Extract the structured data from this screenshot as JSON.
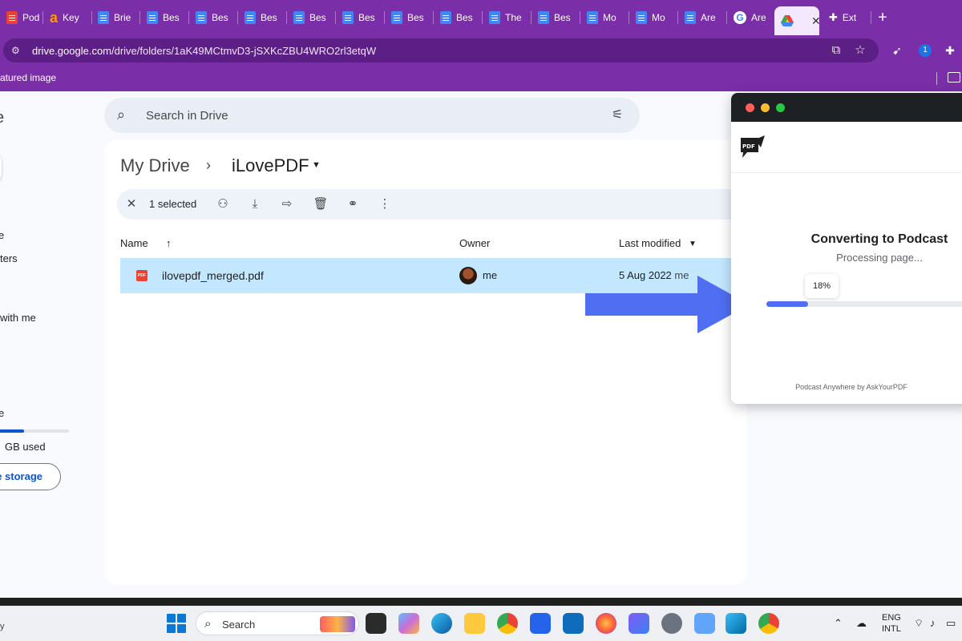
{
  "browser": {
    "tabs": [
      "Pod",
      "Key",
      "Brie",
      "Bes",
      "Bes",
      "Bes",
      "Bes",
      "Bes",
      "Bes",
      "Bes",
      "The",
      "Bes",
      "Mo",
      "Mo",
      "Are",
      "Are",
      "",
      "Ext"
    ],
    "url_host": "drive.google.com",
    "url_path": "/drive/folders/1aK49MCtmvD3-jSXKcZBU4WRO2rl3etqW",
    "bookmark": "atured image",
    "ext_badge": "1"
  },
  "drive": {
    "logo_partial": "e",
    "sidebar": [
      "e",
      "ters",
      "with me",
      "e"
    ],
    "storage_used": "GB used",
    "storage_button": "e storage",
    "storage_fraction": 0.42,
    "search_placeholder": "Search in Drive",
    "breadcrumb_root": "My Drive",
    "breadcrumb_folder": "iLovePDF",
    "selection_count": "1 selected",
    "columns": {
      "name": "Name",
      "owner": "Owner",
      "modified": "Last modified"
    },
    "files": [
      {
        "icon_label": "PDF",
        "name": "ilovepdf_merged.pdf",
        "owner": "me",
        "modified": "5 Aug 2022",
        "modified_by": "me"
      }
    ]
  },
  "popup": {
    "title": "Converting to Podcast",
    "status": "Processing page...",
    "progress_label": "18%",
    "progress": 0.18,
    "footer": "Podcast Anywhere by AskYourPDF",
    "logo_text": "PDF"
  },
  "taskbar": {
    "search_label": "Search",
    "lang_1": "ENG",
    "lang_2": "INTL",
    "corner": "y"
  },
  "colors": {
    "browser_purple": "#7a2fa8",
    "selected_row": "#c2e7ff",
    "arrow": "#4f6ef2",
    "progress": "#4f6ef2"
  }
}
